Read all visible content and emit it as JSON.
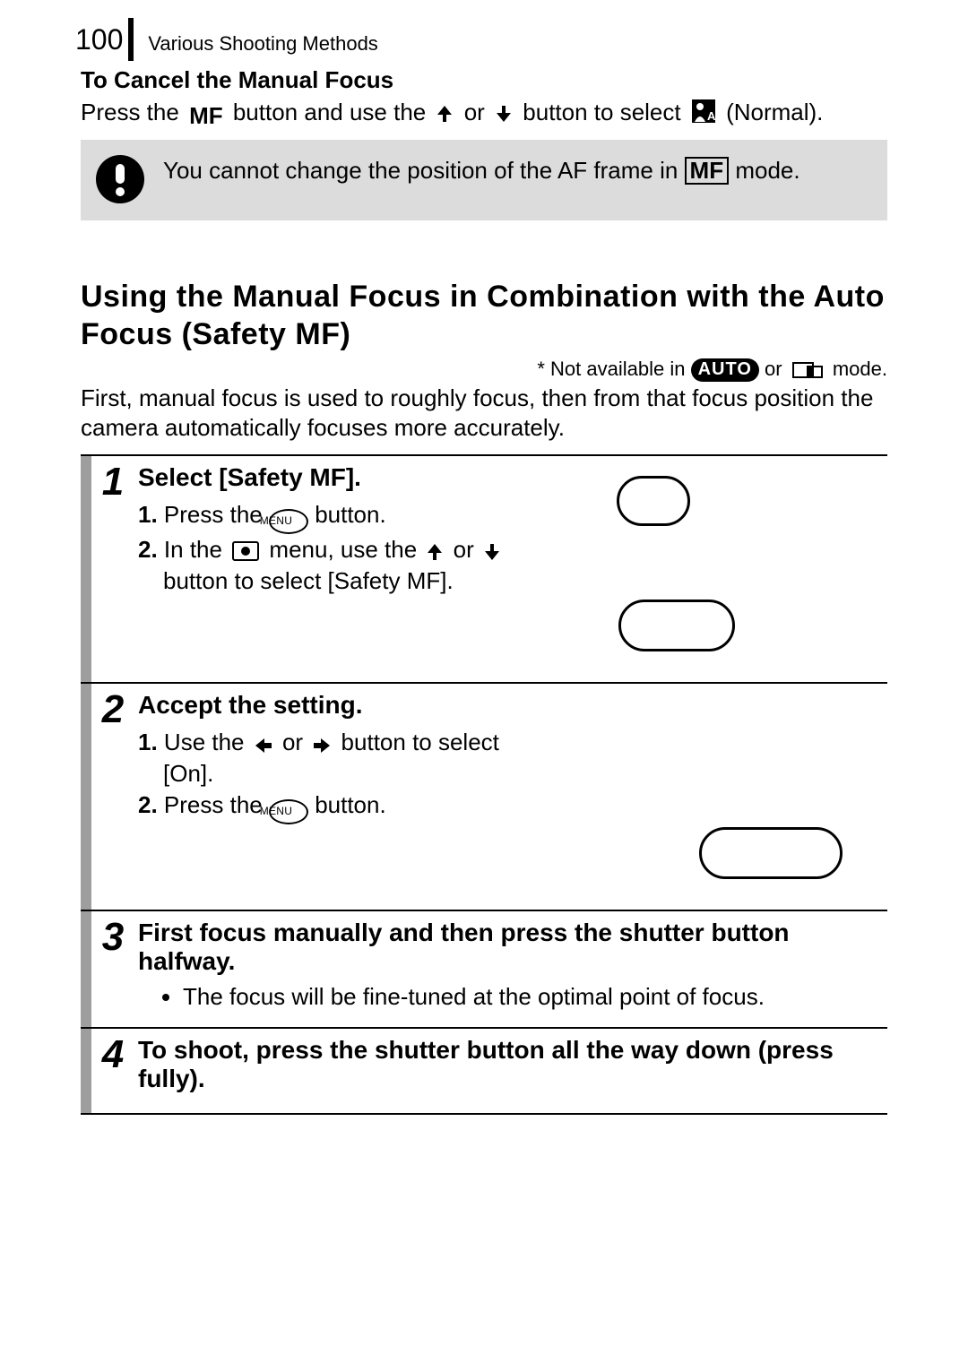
{
  "header": {
    "page_number": "100",
    "section_title": "Various Shooting Methods"
  },
  "cancel": {
    "heading": "To Cancel the Manual Focus",
    "press_the": "Press the ",
    "mf_label": "MF",
    "button_and_use": " button and use the ",
    "or": " or ",
    "button_to_select": " button to select ",
    "normal": " (Normal)."
  },
  "info": {
    "text_a": "You cannot change the position of the AF frame in ",
    "mf_label": "MF",
    "text_b": " mode."
  },
  "section": {
    "heading": "Using the Manual Focus in Combination with the Auto Focus (Safety MF)",
    "note_a": "* Not available in ",
    "auto_label": "AUTO",
    "note_b": " or ",
    "note_c": " mode.",
    "intro": "First, manual focus is used to roughly focus, then from that focus position the camera automatically focuses more accurately."
  },
  "steps": [
    {
      "num": "1",
      "title": "Select [Safety MF].",
      "items": [
        {
          "num": "1.",
          "pre": " Press the ",
          "icon": "menu",
          "post": " button."
        },
        {
          "num": "2.",
          "pre": " In the ",
          "icon": "camera",
          "mid": " menu, use the ",
          "arrows": "ud",
          "post": " button to select [Safety MF]."
        }
      ]
    },
    {
      "num": "2",
      "title": "Accept the setting.",
      "items": [
        {
          "num": "1.",
          "pre": " Use the ",
          "arrows": "lr",
          "post": " button to select [On]."
        },
        {
          "num": "2.",
          "pre": " Press the ",
          "icon": "menu",
          "post": " button."
        }
      ]
    },
    {
      "num": "3",
      "title": "First focus manually and then press the shutter button halfway.",
      "bullets": [
        "The focus will be fine-tuned at the optimal point of focus."
      ]
    },
    {
      "num": "4",
      "title": "To shoot, press the shutter button all the way down (press fully)."
    }
  ]
}
